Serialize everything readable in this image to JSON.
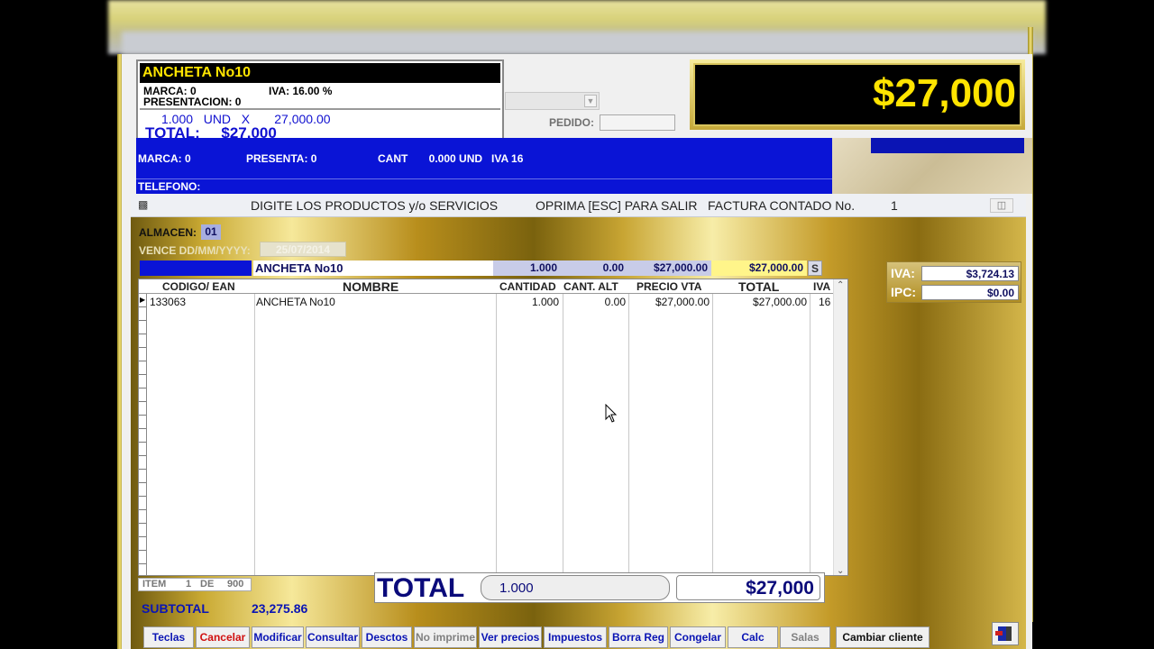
{
  "popup": {
    "title": "ANCHETA No10",
    "marca": "MARCA:   0",
    "iva": "IVA:  16.00 %",
    "presentacion": "PRESENTACION:   0",
    "qty_line": "1.000   UND   X       27,000.00",
    "total_line": "TOTAL:     $27,000"
  },
  "header": {
    "pedido_label": "PEDIDO:",
    "big_total": "$27,000"
  },
  "info_bar": {
    "marca": "MARCA: 0",
    "presenta": "PRESENTA: 0",
    "cant": "CANT       0.000 UND   IVA 16",
    "telefono": "TELEFONO:"
  },
  "dialog": {
    "prompt": "DIGITE LOS PRODUCTOS y/o SERVICIOS",
    "esc_hint": "OPRIMA [ESC] PARA SALIR",
    "factura": "FACTURA CONTADO No.",
    "factura_no": "1",
    "almacen_label": "ALMACEN:",
    "almacen_value": "01",
    "vence_label": "VENCE DD/MM/YYYY:",
    "vence_value": "25/07/2014"
  },
  "entry_row": {
    "name": "ANCHETA No10",
    "qty": "1.000",
    "alt": "0.00",
    "price": "$27,000.00",
    "total": "$27,000.00",
    "s": "S"
  },
  "grid": {
    "columns": [
      "CODIGO/ EAN",
      "NOMBRE",
      "CANTIDAD",
      "CANT. ALT",
      "PRECIO VTA",
      "TOTAL",
      "IVA"
    ],
    "rows": [
      {
        "code": "133063",
        "name": "ANCHETA No10",
        "qty": "1.000",
        "alt": "0.00",
        "price": "$27,000.00",
        "total": "$27,000.00",
        "iva": "16"
      }
    ]
  },
  "footer": {
    "item_label": "ITEM",
    "item_pos": "1",
    "item_de": "DE",
    "item_total": "900",
    "subtotal_label": "SUBTOTAL",
    "subtotal_value": "23,275.86",
    "total_label": "TOTAL",
    "total_qty": "1.000",
    "total_amount": "$27,000"
  },
  "taxes": {
    "iva_label": "IVA:",
    "iva_value": "$3,724.13",
    "ipc_label": "IPC:",
    "ipc_value": "$0.00"
  },
  "buttons": [
    {
      "label": "Teclas"
    },
    {
      "label": "Cancelar"
    },
    {
      "label": "Modificar"
    },
    {
      "label": "Consultar"
    },
    {
      "label": "Desctos"
    },
    {
      "label": "No imprime"
    },
    {
      "label": "Ver precios"
    },
    {
      "label": "Impuestos"
    },
    {
      "label": "Borra Reg"
    },
    {
      "label": "Congelar"
    },
    {
      "label": "Calc"
    },
    {
      "label": "Salas"
    },
    {
      "label": "Cambiar cliente"
    }
  ]
}
